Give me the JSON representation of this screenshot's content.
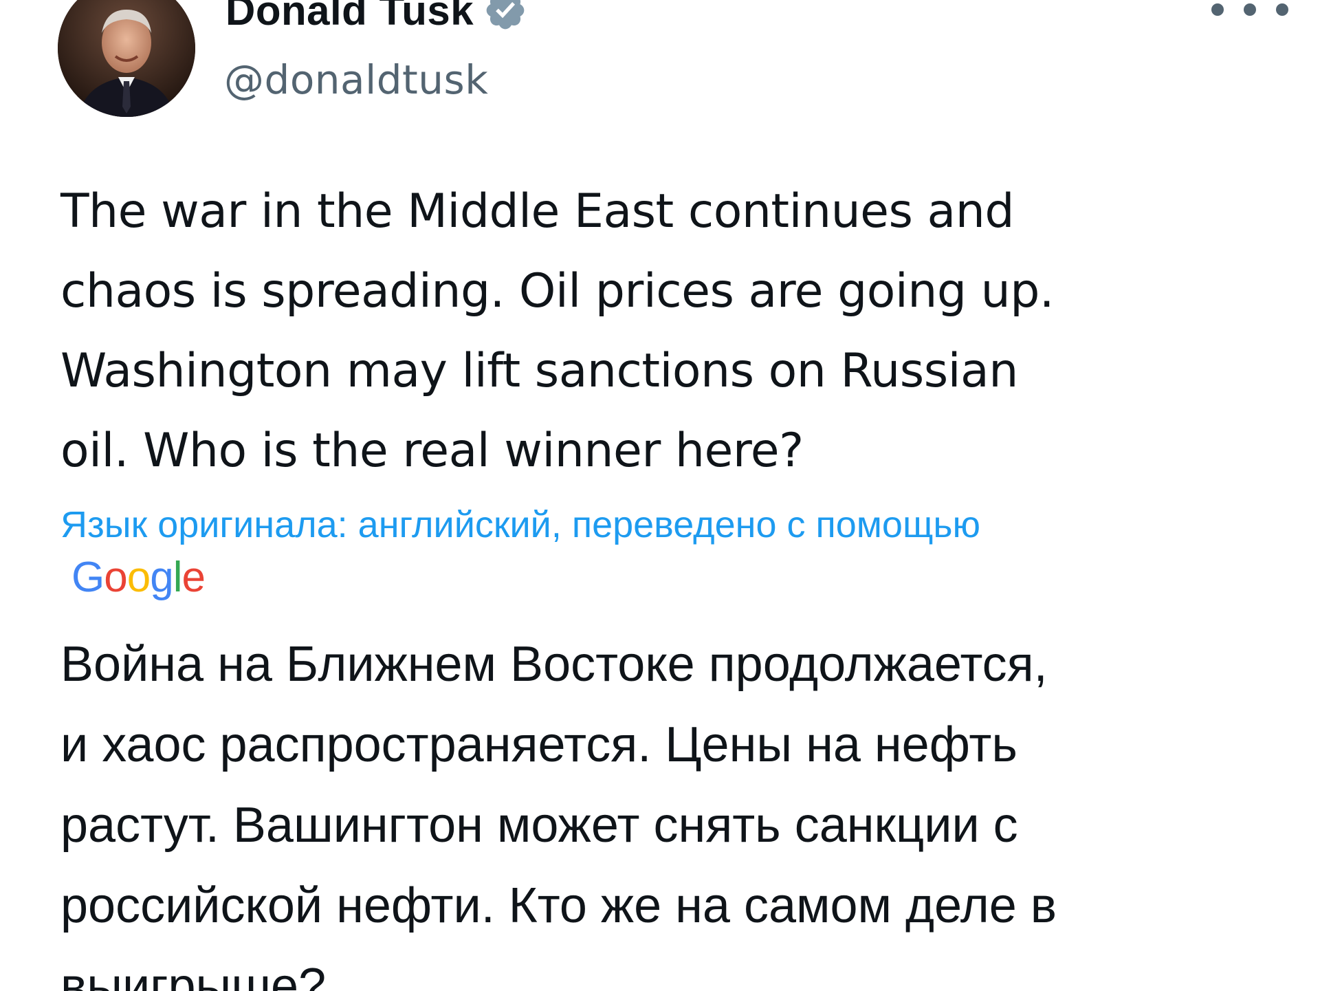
{
  "header": {
    "display_name": "Donald Tusk",
    "handle": "@donaldtusk",
    "verified": true,
    "avatar_icon": "profile-photo",
    "more_icon": "more-horizontal-icon",
    "colors": {
      "handle": "#536471",
      "verified_badge": "#829aab"
    }
  },
  "tweet": {
    "text_en": "The war in the Middle East continues and\nchaos is spreading. Oil prices are going up.\nWashington may lift sanctions on Russian\noil. Who is the real winner here?",
    "translation_note": "Язык оригинала: английский, переведено с помощью",
    "translation_provider": "Google",
    "text_ru": "Война на Ближнем Востоке продолжается,\nи хаос распространяется. Цены на нефть\nрастут. Вашингтон может снять санкции с\nроссийской нефти. Кто же на самом деле в\nвыигрыше?",
    "colors": {
      "link": "#1d9bf0",
      "text": "#0f1419"
    }
  }
}
